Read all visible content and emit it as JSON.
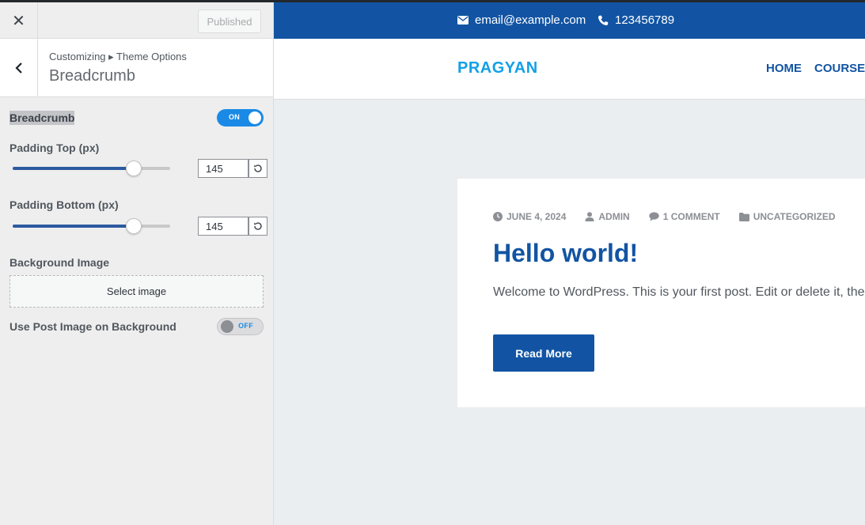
{
  "header": {
    "close_icon": "close-icon",
    "publish_label": "Published"
  },
  "panel": {
    "breadcrumb_path": "Customizing ▸ Theme Options",
    "title": "Breadcrumb"
  },
  "controls": {
    "breadcrumb": {
      "label": "Breadcrumb",
      "state": "ON"
    },
    "padding_top": {
      "label": "Padding Top (px)",
      "value": "145",
      "fraction": 0.77
    },
    "padding_bottom": {
      "label": "Padding Bottom (px)",
      "value": "145",
      "fraction": 0.77
    },
    "background_image": {
      "label": "Background Image",
      "button_label": "Select image"
    },
    "post_image": {
      "label": "Use Post Image on Background",
      "state": "OFF"
    }
  },
  "preview": {
    "email": "email@example.com",
    "phone": "123456789",
    "logo": "PRAGYAN",
    "nav": [
      "HOME",
      "COURSES"
    ],
    "post": {
      "date": "JUNE 4, 2024",
      "author": "ADMIN",
      "comments": "1 COMMENT",
      "category": "UNCATEGORIZED",
      "title": "Hello world!",
      "excerpt": "Welcome to WordPress. This is your first post. Edit or delete it, then start writing!",
      "read_more": "Read More"
    }
  },
  "colors": {
    "brand_blue": "#1254a3",
    "logo_blue": "#12a0e8",
    "toggle_on": "#1a8ae6",
    "slider_fill": "#2c5aa0"
  }
}
